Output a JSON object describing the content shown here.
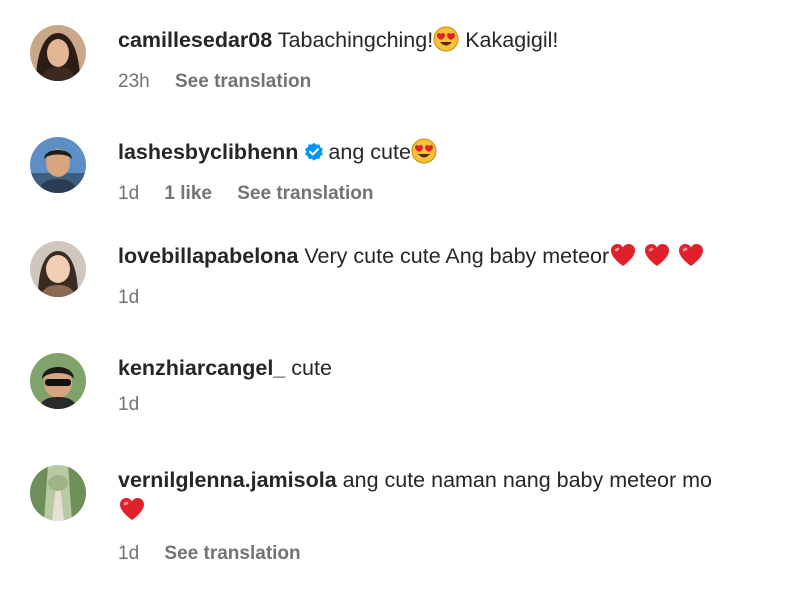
{
  "comments": [
    {
      "username": "camillesedar08",
      "verified": false,
      "text": "Tabachingching!",
      "text_after": "Kakagigil!",
      "time": "23h",
      "likes": "",
      "see_translation": "See translation",
      "emoji": [
        "heart-eyes"
      ]
    },
    {
      "username": "lashesbyclibhenn",
      "verified": true,
      "text": "ang cute",
      "time": "1d",
      "likes": "1 like",
      "see_translation": "See translation",
      "emoji": [
        "heart-eyes"
      ]
    },
    {
      "username": "lovebillapabelona",
      "verified": false,
      "text": "Very cute cute Ang baby meteor",
      "time": "1d",
      "likes": "",
      "see_translation": "",
      "emoji": [
        "red-heart",
        "red-heart",
        "red-heart"
      ]
    },
    {
      "username": "kenzhiarcangel_",
      "verified": false,
      "text": "cute",
      "time": "1d",
      "likes": "",
      "see_translation": "",
      "emoji": []
    },
    {
      "username": "vernilglenna.jamisola",
      "verified": false,
      "text": "ang cute naman nang baby meteor mo",
      "time": "1d",
      "likes": "",
      "see_translation": "See translation",
      "emoji": [
        "red-heart"
      ]
    }
  ],
  "colors": {
    "text": "#262626",
    "meta": "#737373",
    "verified": "#0095f6",
    "heart": "#e0202a",
    "emoji_face": "#f7c13a"
  }
}
